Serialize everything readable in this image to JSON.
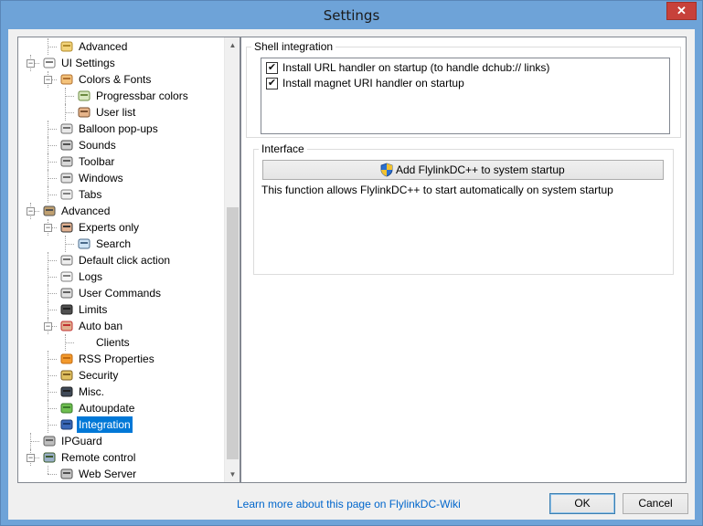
{
  "window": {
    "title": "Settings",
    "close_glyph": "✕"
  },
  "tree": {
    "nodes": [
      {
        "label": "Advanced",
        "icon": "key-icon",
        "depth": 2,
        "expander": "",
        "selected": false
      },
      {
        "label": "UI Settings",
        "icon": "window-icon",
        "depth": 1,
        "expander": "−",
        "selected": false
      },
      {
        "label": "Colors & Fonts",
        "icon": "palette-icon",
        "depth": 2,
        "expander": "−",
        "selected": false
      },
      {
        "label": "Progressbar colors",
        "icon": "progressbar-icon",
        "depth": 3,
        "expander": "",
        "selected": false
      },
      {
        "label": "User list",
        "icon": "users-icon",
        "depth": 3,
        "expander": "",
        "selected": false
      },
      {
        "label": "Balloon pop-ups",
        "icon": "balloon-icon",
        "depth": 2,
        "expander": "",
        "selected": false
      },
      {
        "label": "Sounds",
        "icon": "speaker-icon",
        "depth": 2,
        "expander": "",
        "selected": false
      },
      {
        "label": "Toolbar",
        "icon": "toolbar-icon",
        "depth": 2,
        "expander": "",
        "selected": false
      },
      {
        "label": "Windows",
        "icon": "windows-icon",
        "depth": 2,
        "expander": "",
        "selected": false
      },
      {
        "label": "Tabs",
        "icon": "tabs-icon",
        "depth": 2,
        "expander": "",
        "selected": false
      },
      {
        "label": "Advanced",
        "icon": "tools-icon",
        "depth": 1,
        "expander": "−",
        "selected": false
      },
      {
        "label": "Experts only",
        "icon": "expert-icon",
        "depth": 2,
        "expander": "−",
        "selected": false
      },
      {
        "label": "Search",
        "icon": "magnifier-icon",
        "depth": 3,
        "expander": "",
        "selected": false
      },
      {
        "label": "Default click action",
        "icon": "mouse-icon",
        "depth": 2,
        "expander": "",
        "selected": false
      },
      {
        "label": "Logs",
        "icon": "log-icon",
        "depth": 2,
        "expander": "",
        "selected": false
      },
      {
        "label": "User Commands",
        "icon": "commands-icon",
        "depth": 2,
        "expander": "",
        "selected": false
      },
      {
        "label": "Limits",
        "icon": "gauge-icon",
        "depth": 2,
        "expander": "",
        "selected": false
      },
      {
        "label": "Auto ban",
        "icon": "ban-user-icon",
        "depth": 2,
        "expander": "−",
        "selected": false
      },
      {
        "label": "Clients",
        "icon": "",
        "depth": 3,
        "expander": "",
        "selected": false
      },
      {
        "label": "RSS Properties",
        "icon": "rss-icon",
        "depth": 2,
        "expander": "",
        "selected": false
      },
      {
        "label": "Security",
        "icon": "lock-icon",
        "depth": 2,
        "expander": "",
        "selected": false
      },
      {
        "label": "Misc.",
        "icon": "monitor-icon",
        "depth": 2,
        "expander": "",
        "selected": false
      },
      {
        "label": "Autoupdate",
        "icon": "update-icon",
        "depth": 2,
        "expander": "",
        "selected": false
      },
      {
        "label": "Integration",
        "icon": "integration-icon",
        "depth": 2,
        "expander": "",
        "selected": true
      },
      {
        "label": "IPGuard",
        "icon": "wall-icon",
        "depth": 1,
        "expander": "",
        "selected": false
      },
      {
        "label": "Remote control",
        "icon": "network-icon",
        "depth": 1,
        "expander": "−",
        "selected": false
      },
      {
        "label": "Web Server",
        "icon": "server-icon",
        "depth": 2,
        "expander": "",
        "selected": false
      }
    ],
    "scroll_up_glyph": "▲",
    "scroll_down_glyph": "▼"
  },
  "shell_integration": {
    "title": "Shell integration",
    "options": [
      {
        "label": "Install URL handler on startup (to handle dchub:// links)",
        "checked": true
      },
      {
        "label": "Install magnet URI handler on startup",
        "checked": true
      }
    ],
    "check_glyph": "✔"
  },
  "interface": {
    "title": "Interface",
    "startup_button": "Add FlylinkDC++ to system startup",
    "description": "This function allows FlylinkDC++ to start automatically on system startup"
  },
  "footer": {
    "help_link": "Learn more about this page on FlylinkDC-Wiki",
    "ok_label": "OK",
    "cancel_label": "Cancel"
  },
  "colors": {
    "selection": "#0078d7",
    "link": "#0066cc",
    "close": "#c7413a",
    "frame": "#6ea3d8"
  }
}
